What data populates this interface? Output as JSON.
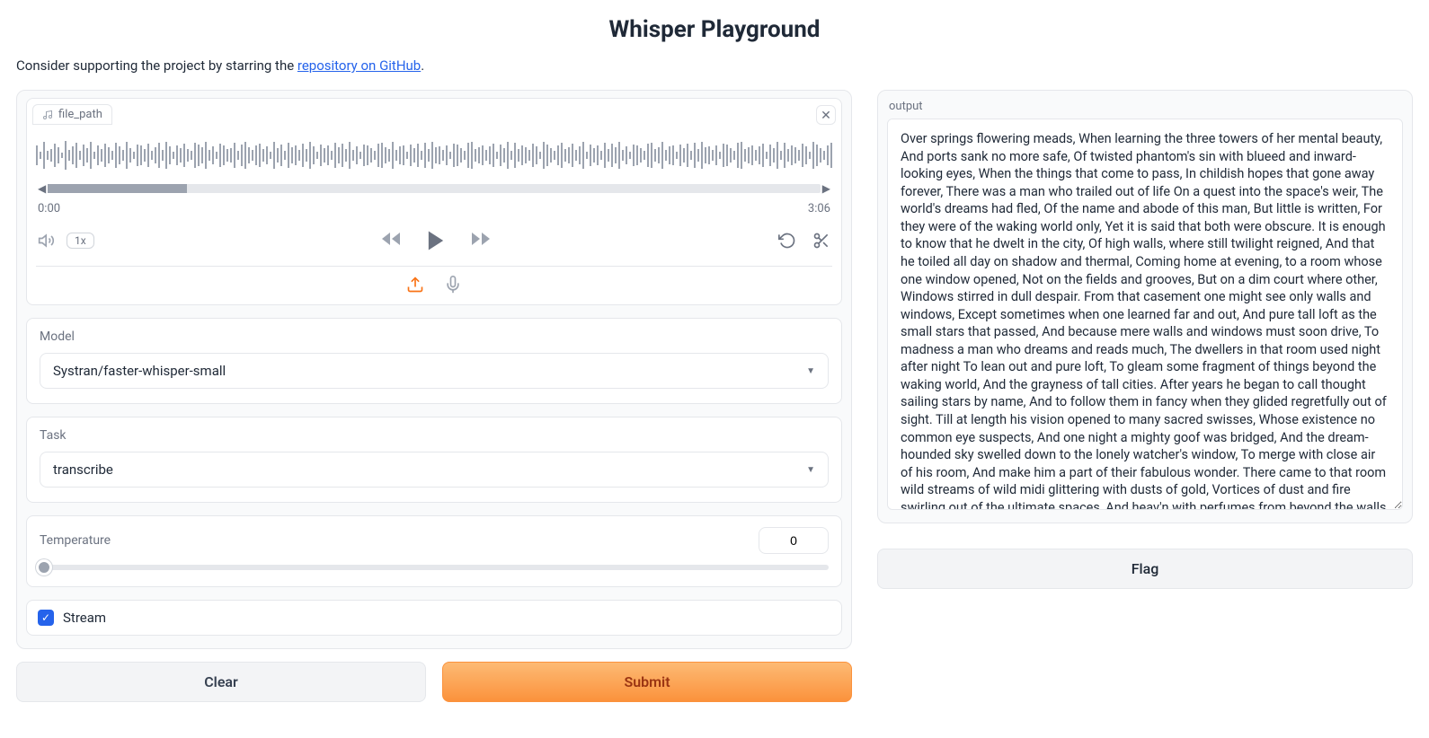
{
  "title": "Whisper Playground",
  "subtitle_prefix": "Consider supporting the project by starring the ",
  "subtitle_link": "repository on GitHub",
  "subtitle_suffix": ".",
  "audio": {
    "file_chip": "file_path",
    "time_start": "0:00",
    "time_end": "3:06",
    "speed": "1x"
  },
  "model": {
    "label": "Model",
    "value": "Systran/faster-whisper-small"
  },
  "task": {
    "label": "Task",
    "value": "transcribe"
  },
  "temperature": {
    "label": "Temperature",
    "value": "0"
  },
  "stream": {
    "label": "Stream",
    "checked": true
  },
  "buttons": {
    "clear": "Clear",
    "submit": "Submit",
    "flag": "Flag"
  },
  "output_label": "output",
  "output_text": "Over springs flowering meads, When learning the three towers of her mental beauty, And ports sank no more safe, Of twisted phantom's sin with blueed and inward-looking eyes, When the things that come to pass, In childish hopes that gone away forever, There was a man who trailed out of life On a quest into the space's weir, The world's dreams had fled, Of the name and abode of this man, But little is written, For they were of the waking world only, Yet it is said that both were obscure. It is enough to know that he dwelt in the city, Of high walls, where still twilight reigned, And that he toiled all day on shadow and thermal, Coming home at evening, to a room whose one window opened, Not on the fields and grooves, But on a dim court where other, Windows stirred in dull despair. From that casement one might see only walls and windows, Except sometimes when one learned far and out, And pure tall loft as the small stars that passed, And because mere walls and windows must soon drive, To madness a man who dreams and reads much, The dwellers in that room used night after night To lean out and pure loft, To gleam some fragment of things beyond the waking world, And the grayness of tall cities. After years he began to call thought sailing stars by name, And to follow them in fancy when they glided regretfully out of sight. Till at length his vision opened to many sacred swisses, Whose existence no common eye suspects, And one night a mighty goof was bridged, And the dream-hounded sky swelled down to the lonely watcher's window, To merge with close air of his room, And make him a part of their fabulous wonder. There came to that room wild streams of wild midi glittering with dusts of gold, Vortices of dust and fire swirling out of the ultimate spaces, And heav'n with perfumes from beyond the walls, Opened oceans poured there, Litten by suns that the eye may never behold, And having in their whirlpool strange dolphins at sea nymphs of unremembered deeps, Noiseless infinity edged around the dreamer, And whiffed him away without even touching his body, That leaned stiffly from the lonely window, And for days not counted in man's calendars, The ties of far spheres bear him gently to join the dreams of which he longed, The dreams that man have lost, And in the course of many cycles, They tenderly left him sleeping on a green sorrow's shore, A green shore fragrant with lotus blossoms, And stard by red camalos."
}
